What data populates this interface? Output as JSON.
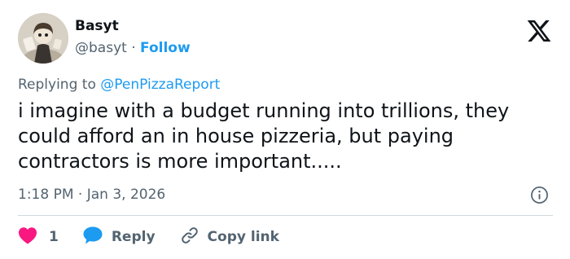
{
  "author": {
    "name": "Basyt",
    "handle": "@basyt",
    "separator": "·",
    "follow_label": "Follow"
  },
  "reply_context": {
    "prefix": "Replying to",
    "mention": "@PenPizzaReport"
  },
  "tweet": {
    "text": "i imagine with a budget running into trillions, they could afford an in house pizzeria, but paying contractors is more important....."
  },
  "meta": {
    "timestamp": "1:18 PM · Jan 3, 2026"
  },
  "actions": {
    "like_count": "1",
    "reply_label": "Reply",
    "copy_label": "Copy link"
  },
  "icons": {
    "brand": "x-logo-icon",
    "info": "info-icon",
    "like": "heart-icon",
    "reply": "speech-bubble-icon",
    "copy": "link-icon"
  },
  "colors": {
    "accent": "#1d9bf0",
    "like": "#f91880",
    "text": "#0f1419",
    "muted": "#536471",
    "divider": "#cfd9de"
  }
}
